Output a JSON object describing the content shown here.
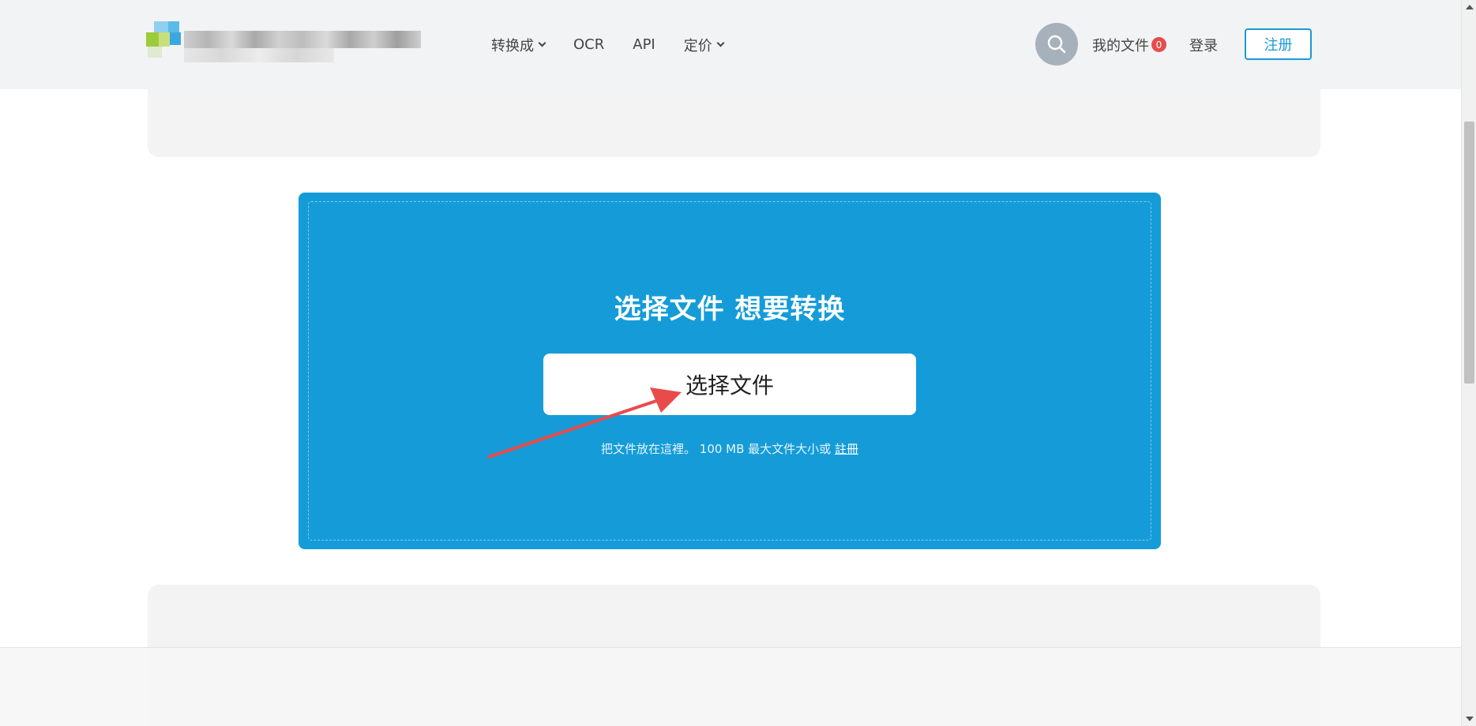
{
  "header": {
    "nav": [
      {
        "label": "转换成",
        "has_dropdown": true
      },
      {
        "label": "OCR",
        "has_dropdown": false
      },
      {
        "label": "API",
        "has_dropdown": false
      },
      {
        "label": "定价",
        "has_dropdown": true
      }
    ],
    "search_icon": "search-icon",
    "my_files_label": "我的文件",
    "my_files_count": "0",
    "login_label": "登录",
    "register_label": "注册"
  },
  "upload": {
    "title": "选择文件 想要转换",
    "choose_button": "选择文件",
    "hint_text": "把文件放在這裡。 100 MB 最大文件大小或 ",
    "hint_link": "註冊"
  },
  "colors": {
    "upload_bg": "#159cd8",
    "accent": "#1a9ad6",
    "badge": "#e74c4c",
    "arrow": "#e94b4b"
  }
}
